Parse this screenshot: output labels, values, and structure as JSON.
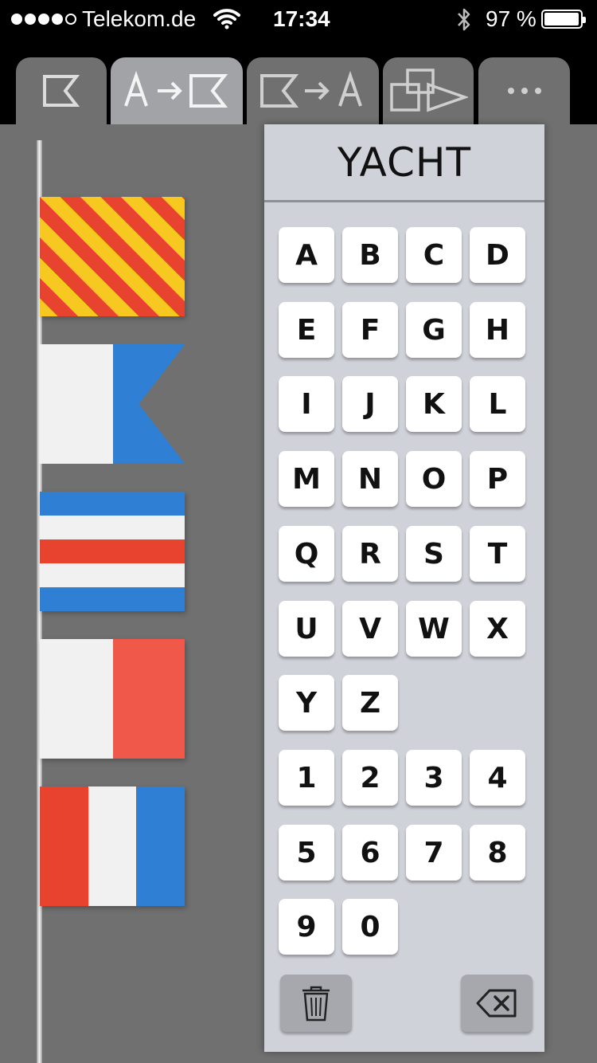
{
  "status_bar": {
    "carrier": "Telekom.de",
    "time": "17:34",
    "battery": "97 %",
    "signal_bars": 4,
    "signal_max": 5
  },
  "tabs": [
    {
      "name": "flag-icon",
      "active": false
    },
    {
      "name": "text-to-flag-icon",
      "active": true
    },
    {
      "name": "flag-to-text-icon",
      "active": false
    },
    {
      "name": "shapes-icon",
      "active": false
    },
    {
      "name": "more-icon",
      "active": false
    }
  ],
  "flags": [
    "Y",
    "A",
    "C",
    "H",
    "T"
  ],
  "word": "YACHT",
  "keyboard": {
    "letters": [
      "A",
      "B",
      "C",
      "D",
      "E",
      "F",
      "G",
      "H",
      "I",
      "J",
      "K",
      "L",
      "M",
      "N",
      "O",
      "P",
      "Q",
      "R",
      "S",
      "T",
      "U",
      "V",
      "W",
      "X",
      "Y",
      "Z"
    ],
    "digits": [
      "1",
      "2",
      "3",
      "4",
      "5",
      "6",
      "7",
      "8",
      "9",
      "0"
    ],
    "clear_icon": "trash-icon",
    "backspace_icon": "backspace-icon"
  },
  "colors": {
    "tab_active": "#a2a3a6",
    "tab_inactive": "#707070",
    "panel": "#d0d2da",
    "flag_red": "#e8432f",
    "flag_yellow": "#f7c81f",
    "flag_blue": "#2f7fd5",
    "flag_white": "#f1f1f1"
  }
}
